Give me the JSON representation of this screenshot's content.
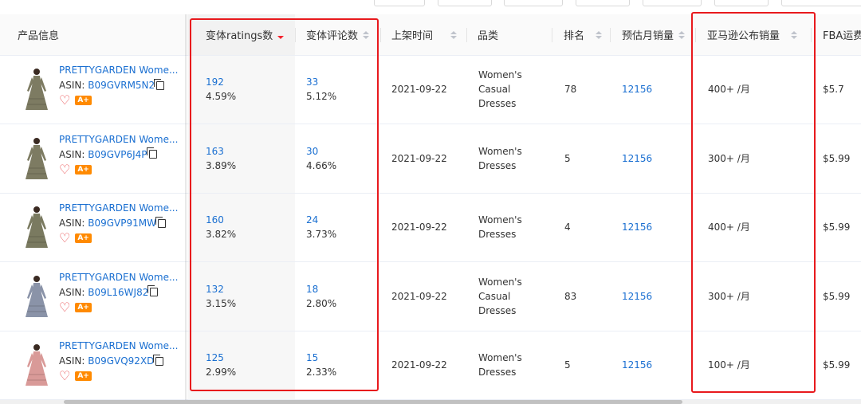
{
  "headers": {
    "product_info": "产品信息",
    "variant_ratings": "变体ratings数",
    "variant_reviews": "变体评论数",
    "listing_date": "上架时间",
    "category": "品类",
    "rank": "排名",
    "est_monthly_sales": "预估月销量",
    "amazon_published_sales": "亚马逊公布销量",
    "fba_fee": "FBA运费"
  },
  "asin_label": "ASIN:",
  "aplus_badge": "A+",
  "rows": [
    {
      "product_name": "PRETTYGARDEN Wome...",
      "asin": "B09GVRM5N2",
      "ratings": "192",
      "ratings_pct": "4.59%",
      "reviews": "33",
      "reviews_pct": "5.12%",
      "date": "2021-09-22",
      "category": [
        "Women's",
        "Casual",
        "Dresses"
      ],
      "rank": "78",
      "est_sales": "12156",
      "amazon_sales": "400+ /月",
      "fba": "$5.7"
    },
    {
      "product_name": "PRETTYGARDEN Wome...",
      "asin": "B09GVP6J4P",
      "ratings": "163",
      "ratings_pct": "3.89%",
      "reviews": "30",
      "reviews_pct": "4.66%",
      "date": "2021-09-22",
      "category": [
        "Women's",
        "Dresses"
      ],
      "rank": "5",
      "est_sales": "12156",
      "amazon_sales": "300+ /月",
      "fba": "$5.99"
    },
    {
      "product_name": "PRETTYGARDEN Wome...",
      "asin": "B09GVP91MW",
      "ratings": "160",
      "ratings_pct": "3.82%",
      "reviews": "24",
      "reviews_pct": "3.73%",
      "date": "2021-09-22",
      "category": [
        "Women's",
        "Dresses"
      ],
      "rank": "4",
      "est_sales": "12156",
      "amazon_sales": "400+ /月",
      "fba": "$5.99"
    },
    {
      "product_name": "PRETTYGARDEN Wome...",
      "asin": "B09L16WJ82",
      "ratings": "132",
      "ratings_pct": "3.15%",
      "reviews": "18",
      "reviews_pct": "2.80%",
      "date": "2021-09-22",
      "category": [
        "Women's",
        "Casual",
        "Dresses"
      ],
      "rank": "83",
      "est_sales": "12156",
      "amazon_sales": "300+ /月",
      "fba": "$5.99"
    },
    {
      "product_name": "PRETTYGARDEN Wome...",
      "asin": "B09GVQ92XD",
      "ratings": "125",
      "ratings_pct": "2.99%",
      "reviews": "15",
      "reviews_pct": "2.33%",
      "date": "2021-09-22",
      "category": [
        "Women's",
        "Dresses"
      ],
      "rank": "5",
      "est_sales": "12156",
      "amazon_sales": "100+ /月",
      "fba": "$5.99"
    }
  ],
  "dress_colors": [
    "#7d7b62",
    "#7d7b62",
    "#7a7a60",
    "#8a93a8",
    "#d99a98"
  ],
  "icons": {
    "sort": "sort-caret-icon",
    "copy": "copy-icon",
    "favorite": "heart-icon"
  },
  "colors": {
    "link": "#1a6fd1",
    "highlight_box": "#e8191d",
    "aplus": "#ff8a00",
    "heart": "#e8474a"
  }
}
